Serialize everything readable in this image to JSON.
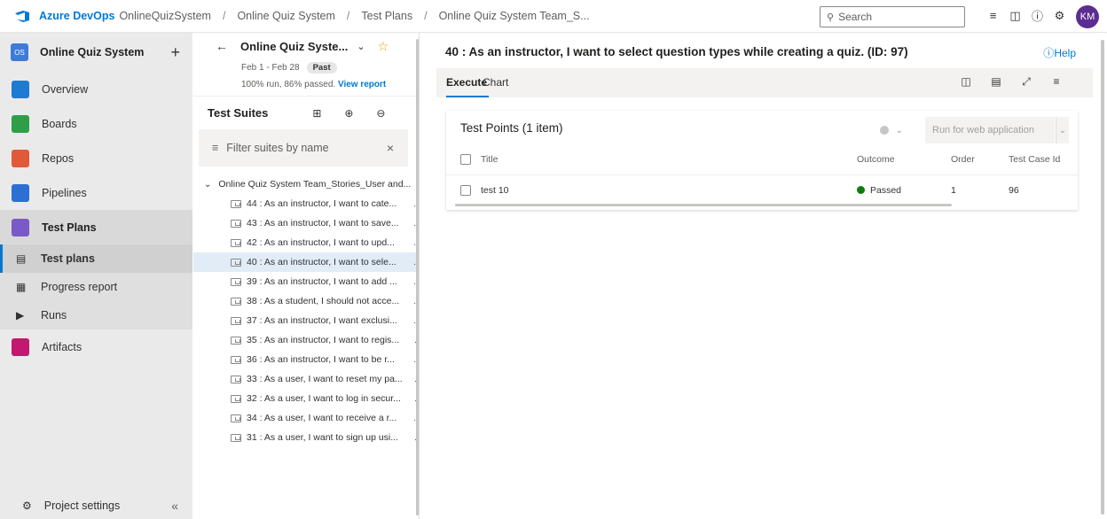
{
  "topbar": {
    "brand": "Azure DevOps",
    "breadcrumbs": [
      "OnlineQuizSystem",
      "Online Quiz System",
      "Test Plans",
      "Online Quiz System Team_S..."
    ],
    "search_placeholder": "Search",
    "avatar_initials": "KM"
  },
  "nav": {
    "project_badge": "OS",
    "project_name": "Online Quiz System",
    "items": {
      "overview": "Overview",
      "boards": "Boards",
      "repos": "Repos",
      "pipelines": "Pipelines",
      "testplans": "Test Plans",
      "artifacts": "Artifacts"
    },
    "sub_items": {
      "test_plans": "Test plans",
      "progress_report": "Progress report",
      "runs": "Runs"
    },
    "settings": "Project settings",
    "colors": {
      "overview": "#1f7ad3",
      "boards": "#2f9e48",
      "repos": "#e05a3a",
      "pipelines": "#2d6fd3",
      "testplans": "#7a5ac8",
      "artifacts": "#c3186e"
    }
  },
  "plan": {
    "name": "Online Quiz Syste...",
    "dates": "Feb 1 - Feb 28",
    "status": "Past",
    "stats": "100% run, 86% passed.",
    "view_report": "View report"
  },
  "suites": {
    "title": "Test Suites",
    "filter_placeholder": "Filter suites by name",
    "root": "Online Quiz System Team_Stories_User and...",
    "items": [
      "44 : As an instructor, I want to cate...",
      "43 : As an instructor, I want to save...",
      "42 : As an instructor, I want to upd...",
      "40 : As an instructor, I want to sele...",
      "39 : As an instructor, I want to add ...",
      "38 : As a student, I should not acce...",
      "37 : As an instructor, I want exclusi...",
      "35 : As an instructor, I want to regis...",
      "36 : As an instructor, I want to be r...",
      "33 : As a user, I want to reset my pa...",
      "32 : As a user, I want to log in secur...",
      "34 : As a user, I want to receive a r...",
      "31 : As a user, I want to sign up usi..."
    ]
  },
  "main": {
    "title": "40 : As an instructor, I want to select question types while creating a quiz. (ID: 97)",
    "help": "Help",
    "tabs": [
      "Execute",
      "Chart"
    ],
    "card_title": "Test Points (1 item)",
    "run_button": "Run for web application",
    "columns": [
      "Title",
      "Outcome",
      "Order",
      "Test Case Id"
    ],
    "rows": [
      {
        "title": "test 10",
        "outcome": "Passed",
        "order": "1",
        "test_case_id": "96"
      }
    ]
  }
}
